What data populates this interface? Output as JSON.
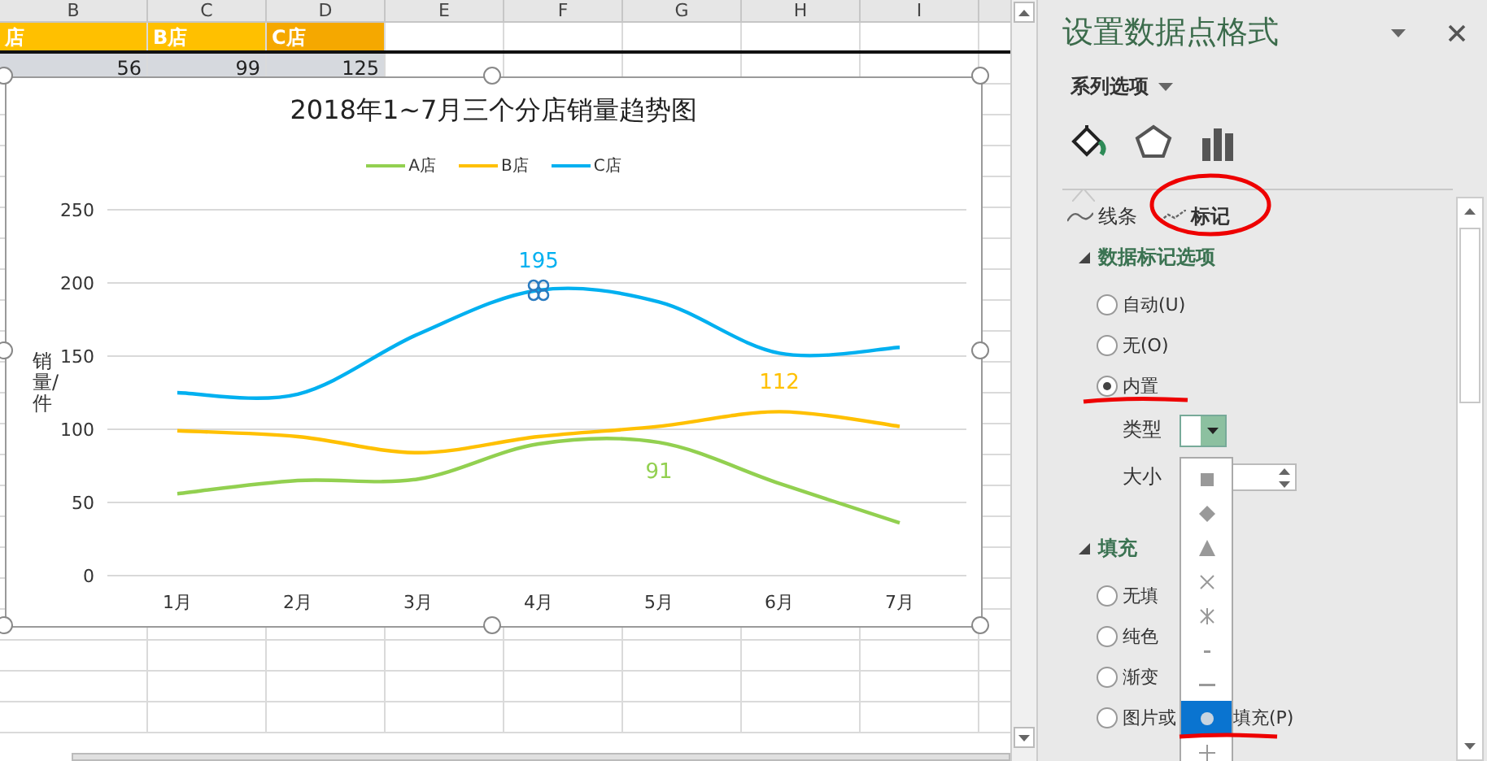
{
  "sheet": {
    "columns": [
      "B",
      "C",
      "D",
      "E",
      "F",
      "G",
      "H",
      "I"
    ],
    "rows": [
      {
        "cells": [
          "店",
          "B店",
          "C店"
        ]
      },
      {
        "cells": [
          "56",
          "99",
          "125"
        ]
      }
    ]
  },
  "chart": {
    "title": "2018年1~7月三个分店销量趋势图",
    "y_axis_title": "销量/件",
    "chart_data": {
      "type": "line",
      "grid": true,
      "categories": [
        "1月",
        "2月",
        "3月",
        "4月",
        "5月",
        "6月",
        "7月"
      ],
      "ylim": [
        0,
        250
      ],
      "yticks": [
        0,
        50,
        100,
        150,
        200,
        250
      ],
      "series": [
        {
          "name": "A店",
          "color": "#92d050",
          "values": [
            56,
            65,
            66,
            90,
            91,
            63,
            36
          ]
        },
        {
          "name": "B店",
          "color": "#ffc000",
          "values": [
            99,
            95,
            84,
            95,
            102,
            112,
            102
          ]
        },
        {
          "name": "C店",
          "color": "#00b0f0",
          "values": [
            125,
            124,
            165,
            195,
            187,
            152,
            156
          ]
        }
      ],
      "annotations": [
        {
          "x": "4月",
          "y": 195,
          "text": "195"
        },
        {
          "x": "6月",
          "y": 112,
          "text": "112"
        },
        {
          "x": "5月",
          "y": 91,
          "text": "91"
        }
      ]
    }
  },
  "panel": {
    "title": "设置数据点格式",
    "series_menu": "系列选项",
    "icon_tabs": [
      {
        "kind": "fill",
        "selected": true
      },
      {
        "kind": "effects",
        "selected": false
      },
      {
        "kind": "series",
        "selected": false
      }
    ],
    "tabs": [
      {
        "label": "线条",
        "selected": false
      },
      {
        "label": "标记",
        "selected": true
      }
    ],
    "marker_section": {
      "title": "数据标记选项",
      "expanded": true,
      "options": [
        {
          "label": "自动(U)",
          "selected": false
        },
        {
          "label": "无(O)",
          "selected": false
        },
        {
          "label": "内置",
          "selected": true
        }
      ],
      "type_label": "类型",
      "size_label": "大小"
    },
    "marker_list": [
      {
        "kind": "square",
        "selected": false
      },
      {
        "kind": "diamond",
        "selected": false
      },
      {
        "kind": "triangle",
        "selected": false
      },
      {
        "kind": "x",
        "selected": false
      },
      {
        "kind": "star",
        "selected": false
      },
      {
        "kind": "short-dash",
        "selected": false
      },
      {
        "kind": "dash",
        "selected": false
      },
      {
        "kind": "circle",
        "selected": true
      },
      {
        "kind": "plus",
        "selected": false
      }
    ],
    "fill_section": {
      "title": "填充",
      "expanded": true,
      "options": [
        {
          "label": "无填",
          "selected": false
        },
        {
          "label": "纯色",
          "selected": false
        },
        {
          "label": "渐变",
          "selected": false
        },
        {
          "label": "图片或",
          "tail": "填充(P)",
          "selected": false
        }
      ]
    }
  }
}
